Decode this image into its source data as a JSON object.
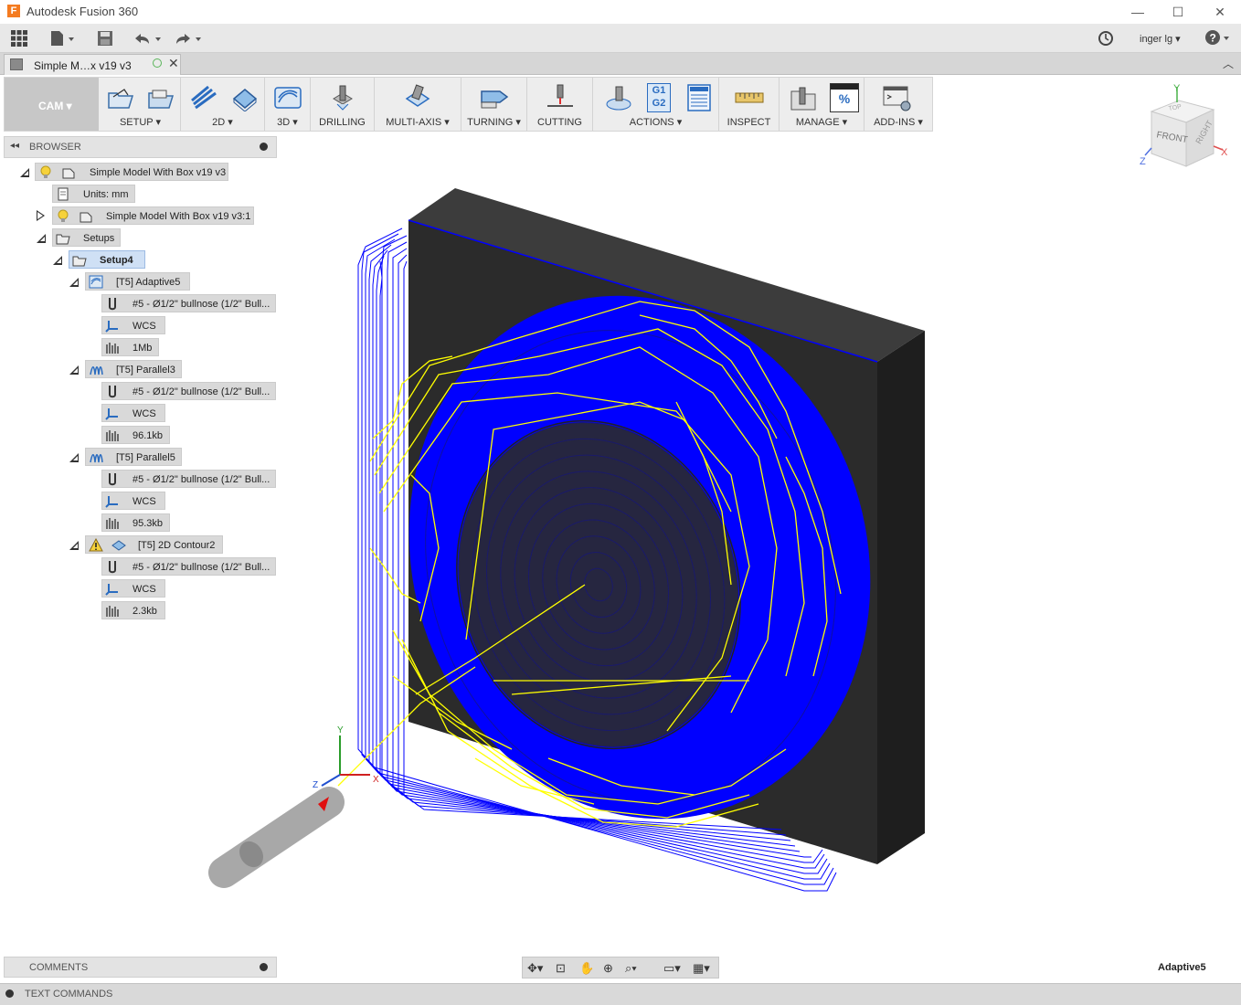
{
  "window": {
    "title": "Autodesk Fusion 360",
    "minimize": "—",
    "maximize": "☐",
    "close": "✕"
  },
  "qat": {
    "user": "inger lg ▾",
    "help": "?"
  },
  "document": {
    "tab_title": "Simple M…x v19 v3"
  },
  "toolbar": {
    "workspace": "CAM ▾",
    "groups": [
      {
        "label": "SETUP ▾"
      },
      {
        "label": "2D ▾"
      },
      {
        "label": "3D ▾"
      },
      {
        "label": "DRILLING"
      },
      {
        "label": "MULTI-AXIS ▾"
      },
      {
        "label": "TURNING ▾"
      },
      {
        "label": "CUTTING"
      },
      {
        "label": "ACTIONS ▾"
      },
      {
        "label": "INSPECT"
      },
      {
        "label": "MANAGE ▾"
      },
      {
        "label": "ADD-INS ▾"
      }
    ],
    "actions_g1": "G1",
    "actions_g2": "G2",
    "manage_pct": "%"
  },
  "browser": {
    "header": "BROWSER",
    "root": "Simple Model With Box v19 v3",
    "units": "Units: mm",
    "component": "Simple Model With Box v19 v3:1",
    "setups": "Setups",
    "setup": "Setup4",
    "operations": [
      {
        "name": "[T5] Adaptive5",
        "tool": "#5 - Ø1/2\" bullnose (1/2\" Bull...",
        "wcs": "WCS",
        "size": "1Mb"
      },
      {
        "name": "[T5] Parallel3",
        "tool": "#5 - Ø1/2\" bullnose (1/2\" Bull...",
        "wcs": "WCS",
        "size": "96.1kb"
      },
      {
        "name": "[T5] Parallel5",
        "tool": "#5 - Ø1/2\" bullnose (1/2\" Bull...",
        "wcs": "WCS",
        "size": "95.3kb"
      },
      {
        "name": "[T5] 2D Contour2",
        "tool": "#5 - Ø1/2\" bullnose (1/2\" Bull...",
        "wcs": "WCS",
        "size": "2.3kb"
      }
    ]
  },
  "viewcube": {
    "top": "TOP",
    "front": "FRONT",
    "right": "RIGHT",
    "axis_x": "X",
    "axis_y": "Y",
    "axis_z": "Z"
  },
  "triad": {
    "x": "X",
    "y": "Y",
    "z": "Z"
  },
  "colors": {
    "toolpath_blue": "#0000ff",
    "toolpath_yellow": "#ffff00",
    "stock": "#2a2a2a"
  },
  "bottom": {
    "comments": "COMMENTS",
    "active_operation": "Adaptive5",
    "text_commands": "TEXT COMMANDS"
  }
}
